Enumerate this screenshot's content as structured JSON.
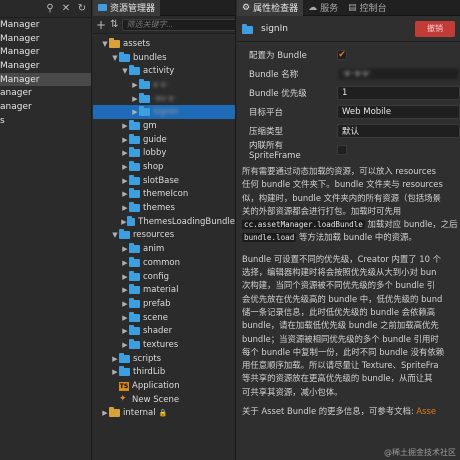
{
  "left_panel": {
    "icons": [
      "search-icon",
      "close-icon",
      "refresh-icon"
    ],
    "rows": [
      "Manager",
      "Manager",
      "Manager",
      "Manager",
      "Manager",
      "anager",
      "anager",
      "s"
    ]
  },
  "assets_panel": {
    "tab": "资源管理器",
    "search_placeholder": "筛选关键字...",
    "tree": [
      {
        "label": "assets",
        "indent": 0,
        "arrow": "▼",
        "icon": "folder-yellow"
      },
      {
        "label": "bundles",
        "indent": 1,
        "arrow": "▼",
        "icon": "folder"
      },
      {
        "label": "activity",
        "indent": 2,
        "arrow": "▼",
        "icon": "folder"
      },
      {
        "label": "",
        "indent": 3,
        "arrow": "▶",
        "icon": "folder",
        "blur": true,
        "blur_text": "x·v·"
      },
      {
        "label": "",
        "indent": 3,
        "arrow": "▶",
        "icon": "folder",
        "blur": true,
        "blur_text": "·xv·x·"
      },
      {
        "label": "",
        "indent": 3,
        "arrow": "▶",
        "icon": "folder",
        "blur": true,
        "blur_text": "signIn",
        "selected": true
      },
      {
        "label": "gm",
        "indent": 2,
        "arrow": "▶",
        "icon": "folder"
      },
      {
        "label": "guide",
        "indent": 2,
        "arrow": "▶",
        "icon": "folder"
      },
      {
        "label": "lobby",
        "indent": 2,
        "arrow": "▶",
        "icon": "folder"
      },
      {
        "label": "shop",
        "indent": 2,
        "arrow": "▶",
        "icon": "folder"
      },
      {
        "label": "slotBase",
        "indent": 2,
        "arrow": "▶",
        "icon": "folder"
      },
      {
        "label": "themeIcon",
        "indent": 2,
        "arrow": "▶",
        "icon": "folder"
      },
      {
        "label": "themes",
        "indent": 2,
        "arrow": "▶",
        "icon": "folder"
      },
      {
        "label": "ThemesLoadingBundle",
        "indent": 2,
        "arrow": "▶",
        "icon": "folder"
      },
      {
        "label": "resources",
        "indent": 1,
        "arrow": "▼",
        "icon": "folder"
      },
      {
        "label": "anim",
        "indent": 2,
        "arrow": "▶",
        "icon": "folder"
      },
      {
        "label": "common",
        "indent": 2,
        "arrow": "▶",
        "icon": "folder"
      },
      {
        "label": "config",
        "indent": 2,
        "arrow": "▶",
        "icon": "folder"
      },
      {
        "label": "material",
        "indent": 2,
        "arrow": "▶",
        "icon": "folder"
      },
      {
        "label": "prefab",
        "indent": 2,
        "arrow": "▶",
        "icon": "folder"
      },
      {
        "label": "scene",
        "indent": 2,
        "arrow": "▶",
        "icon": "folder"
      },
      {
        "label": "shader",
        "indent": 2,
        "arrow": "▶",
        "icon": "folder"
      },
      {
        "label": "textures",
        "indent": 2,
        "arrow": "▶",
        "icon": "folder"
      },
      {
        "label": "scripts",
        "indent": 1,
        "arrow": "▶",
        "icon": "folder"
      },
      {
        "label": "thirdLib",
        "indent": 1,
        "arrow": "▶",
        "icon": "folder"
      },
      {
        "label": "Application",
        "indent": 1,
        "arrow": "",
        "icon": "ts"
      },
      {
        "label": "New Scene",
        "indent": 1,
        "arrow": "",
        "icon": "scene"
      },
      {
        "label": "internal",
        "indent": 0,
        "arrow": "▶",
        "icon": "folder-yellow",
        "lock": true
      }
    ]
  },
  "inspector": {
    "tabs": [
      "属性检查器",
      "服务",
      "控制台"
    ],
    "title": "signIn",
    "cancel_label": "撤销",
    "props": [
      {
        "label": "配置为 Bundle",
        "type": "check",
        "value": "✔"
      },
      {
        "label": "Bundle 名称",
        "type": "text",
        "value": "·x··x·v·",
        "blur": true
      },
      {
        "label": "Bundle 优先级",
        "type": "text",
        "value": "1"
      },
      {
        "label": "目标平台",
        "type": "text",
        "value": "Web Mobile"
      },
      {
        "label": "压缩类型",
        "type": "text",
        "value": "默认"
      },
      {
        "label": "内联所有 SpriteFrame",
        "type": "check",
        "value": ""
      }
    ],
    "desc1": [
      "所有需要通过动态加载的资源，可以放入 resources",
      "任何 bundle 文件夹下。bundle 文件夹与 resources",
      "似，构建时，bundle 文件夹内的所有资源（包括场景",
      "关的外部资源都会进行打包。加载时可先用",
      [
        "code",
        "cc.assetManager.loadBundle",
        " 加载对应 bundle，之后"
      ],
      [
        "code",
        "bundle.load",
        " 等方法加载 bundle 中的资源。"
      ]
    ],
    "desc2": [
      "Bundle 可设置不同的优先级，Creator 内置了 10 个",
      "选择，编辑器构建时将会按照优先级从大到小对 bun",
      "次构建，当同个资源被不同优先级的多个 bundle 引",
      "会优先放在优先级高的 bundle 中，低优先级的 bund",
      "储一条记录信息，此时低优先级的 bundle 会依赖高",
      "bundle，请在加载低优先级 bundle 之前加载高优先",
      "bundle；当资源被相同优先级的多个 bundle 引用时",
      "每个 bundle 中复制一份，此时不同 bundle 没有依赖",
      "用任意顺序加载。所以请尽量让 Texture、SpriteFra",
      "等共享的资源放在更高优先级的 bundle，从而让其",
      "可共享其资源，减小包体。"
    ],
    "more_prefix": "关于 Asset Bundle 的更多信息，可参考文档: ",
    "more_link": "Asse"
  },
  "watermark": "@稀土掘金技术社区"
}
